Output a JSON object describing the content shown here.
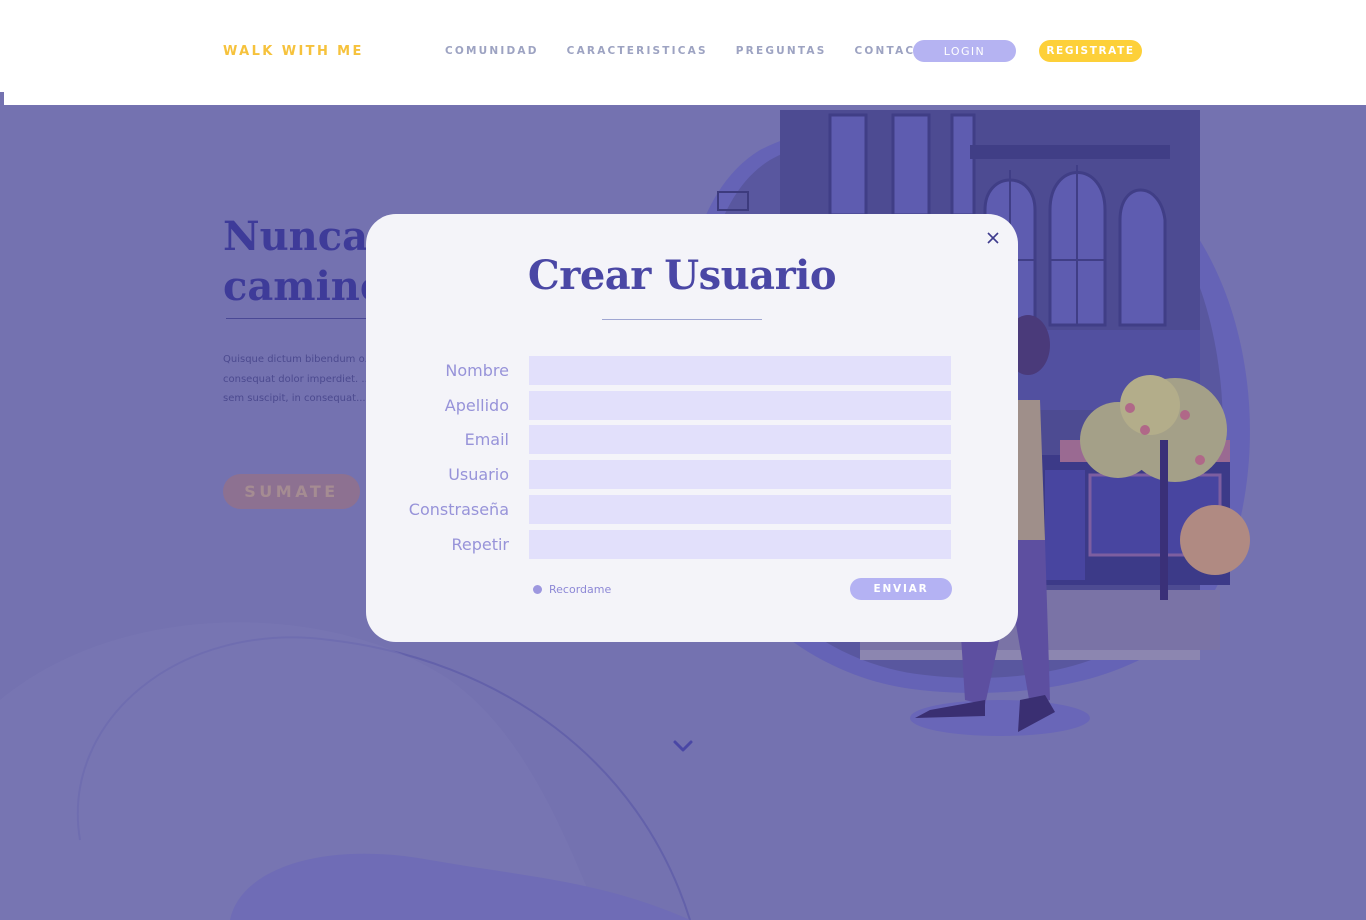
{
  "navbar": {
    "brand": "WALK WITH ME",
    "links": [
      "COMUNIDAD",
      "CARACTERISTICAS",
      "PREGUNTAS",
      "CONTACTO"
    ],
    "login_label": "LOGIN",
    "register_label": "REGISTRATE"
  },
  "hero": {
    "title": "Nunca más camines sola",
    "paragraph": "Quisque dictum bibendum o... laoreet et. Nunc dapibus sap... consequat dolor imperdiet. ... odio, et sodales tortor laore... a sem suscipit, in consequat...",
    "cta_label": "SUMATE"
  },
  "modal": {
    "title": "Crear Usuario",
    "fields": [
      {
        "label": "Nombre",
        "value": ""
      },
      {
        "label": "Apellido",
        "value": ""
      },
      {
        "label": "Email",
        "value": ""
      },
      {
        "label": "Usuario",
        "value": ""
      },
      {
        "label": "Constraseña",
        "value": ""
      },
      {
        "label": "Repetir",
        "value": ""
      }
    ],
    "remember_label": "Recordame",
    "submit_label": "ENVIAR"
  },
  "colors": {
    "overlay_bg": "#7472b0",
    "brand_yellow": "#f6c23c",
    "accent_purple": "#4a47a5",
    "input_bg": "#e2e0fb",
    "login_button": "#b5b3f2",
    "register_button": "#fdd039"
  },
  "icons": {
    "close": "close-icon",
    "scroll": "chevron-down-icon"
  }
}
